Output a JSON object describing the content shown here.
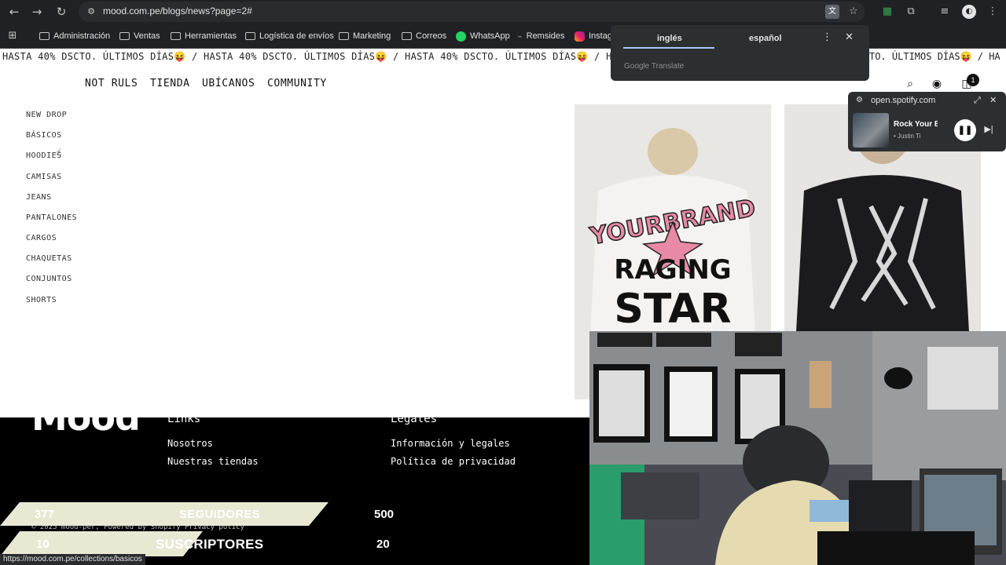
{
  "browser": {
    "url": "mood.com.pe/blogs/news?page=2#",
    "bookmarks": [
      {
        "label": "Administración"
      },
      {
        "label": "Ventas"
      },
      {
        "label": "Herramientas"
      },
      {
        "label": "Logística de envíos"
      },
      {
        "label": "Marketing"
      },
      {
        "label": "Correos"
      },
      {
        "label": "WhatsApp"
      },
      {
        "label": "Remsides"
      },
      {
        "label": "Instag"
      }
    ],
    "status_url": "https://mood.com.pe/collections/basicos"
  },
  "translate_popup": {
    "tab_from": "inglés",
    "tab_to": "español",
    "brand": "Google Translate"
  },
  "spotify": {
    "site": "open.spotify.com",
    "title": "Rock Your B",
    "artist": "• Justin Ti"
  },
  "site": {
    "marquee": "HASTA 40% DSCTO.  ÚLTIMOS DÍAS😝 / HASTA 40% DSCTO.  ÚLTIMOS DÍAS😝 / HASTA 40% DSCTO.  ÚLTIMOS DÍAS😝 / HA",
    "marquee_right": "TO.  ÚLTIMOS DÍAS😝 / HA",
    "nav": [
      "NOT RULS",
      "TIENDA",
      "UBÍCANOS",
      "COMMUNITY"
    ],
    "cart_count": "1",
    "categories": [
      "NEW DROP",
      "BÁSICOS",
      "HOODIES",
      "CAMISAS",
      "JEANS",
      "PANTALONES",
      "CARGOS",
      "CHAQUETAS",
      "CONJUNTOS",
      "SHORTS"
    ],
    "product_1_print": {
      "line1": "YOURBRAND",
      "line2": "RAGING",
      "line3": "STAR"
    }
  },
  "footer": {
    "logo": "Mood",
    "links_heading": "Links",
    "links": [
      "Nosotros",
      "Nuestras tiendas"
    ],
    "legal_heading": "Legales",
    "legal": [
      "Información y legales",
      "Política de privacidad"
    ],
    "copyright": "© 2025 mood-per, Powered by Shopify   Privacy policy"
  },
  "stream_overlay": {
    "followers_current": "377",
    "followers_label": "SEGUIDORES",
    "followers_goal": "500",
    "subs_current": "10",
    "subs_label": "SUSCRIPTORES",
    "subs_goal": "20"
  },
  "colors": {
    "chrome_bg": "#202124",
    "overlay_bar": "#e9e8d3",
    "footer_bg": "#000000"
  }
}
